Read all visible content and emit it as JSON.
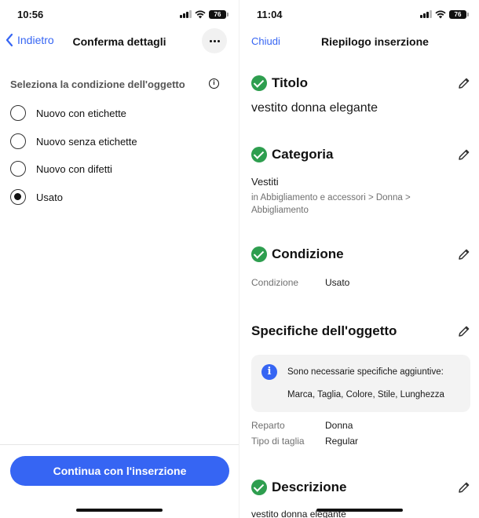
{
  "left": {
    "status": {
      "time": "10:56",
      "battery": "76"
    },
    "nav": {
      "back_label": "Indietro",
      "title": "Conferma dettagli"
    },
    "section_label": "Seleziona la condizione dell'oggetto",
    "options": [
      {
        "label": "Nuovo con etichette",
        "checked": false
      },
      {
        "label": "Nuovo senza etichette",
        "checked": false
      },
      {
        "label": "Nuovo con difetti",
        "checked": false
      },
      {
        "label": "Usato",
        "checked": true
      }
    ],
    "continue_label": "Continua con l'inserzione"
  },
  "right": {
    "status": {
      "time": "11:04",
      "battery": "76"
    },
    "nav": {
      "close_label": "Chiudi",
      "title": "Riepilogo inserzione"
    },
    "titolo": {
      "heading": "Titolo",
      "value": "vestito donna elegante"
    },
    "categoria": {
      "heading": "Categoria",
      "value": "Vestiti",
      "path": "in Abbigliamento e accessori > Donna > Abbigliamento"
    },
    "condizione": {
      "heading": "Condizione",
      "key": "Condizione",
      "value": "Usato"
    },
    "specifiche": {
      "heading": "Specifiche dell'oggetto",
      "info_text": "Sono necessarie specifiche aggiuntive:",
      "info_list": "Marca, Taglia, Colore, Stile, Lunghezza",
      "rows": [
        {
          "key": "Reparto",
          "value": "Donna"
        },
        {
          "key": "Tipo di taglia",
          "value": "Regular"
        }
      ]
    },
    "descrizione": {
      "heading": "Descrizione",
      "value": "vestito donna elegante"
    }
  },
  "colors": {
    "accent": "#3665f3",
    "success": "#2e9e4f"
  }
}
